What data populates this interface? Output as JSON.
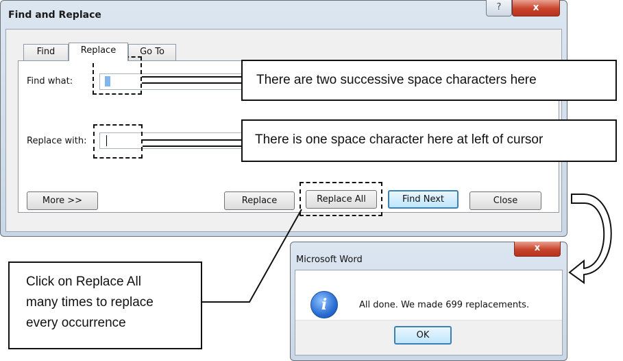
{
  "find_replace": {
    "title": "Find and Replace",
    "help_glyph": "?",
    "close_glyph": "x",
    "tabs": [
      {
        "label": "Find",
        "underline": "n"
      },
      {
        "label": "Replace",
        "underline": "p"
      },
      {
        "label": "Go To",
        "underline": "G"
      }
    ],
    "find_label": "Find what:",
    "replace_label": "Replace with:",
    "find_value": "  ",
    "replace_value": " ",
    "buttons": {
      "more": "More >>",
      "replace": "Replace",
      "replace_all": "Replace All",
      "find_next": "Find Next",
      "close": "Close"
    }
  },
  "annotations": {
    "find_callout": "There are two successive space characters here",
    "replace_callout": "There is one space character here at left of cursor",
    "click_callout": [
      "Click on Replace All",
      "many times to replace",
      "every occurrence"
    ]
  },
  "message_box": {
    "title": "Microsoft Word",
    "close_glyph": "x",
    "message": "All done. We made 699 replacements.",
    "ok_label": "OK",
    "icon": "info-icon"
  },
  "colors": {
    "selection": "#7fb6f0",
    "close_button": "#c8432b",
    "default_button_border": "#3c7fb1"
  }
}
